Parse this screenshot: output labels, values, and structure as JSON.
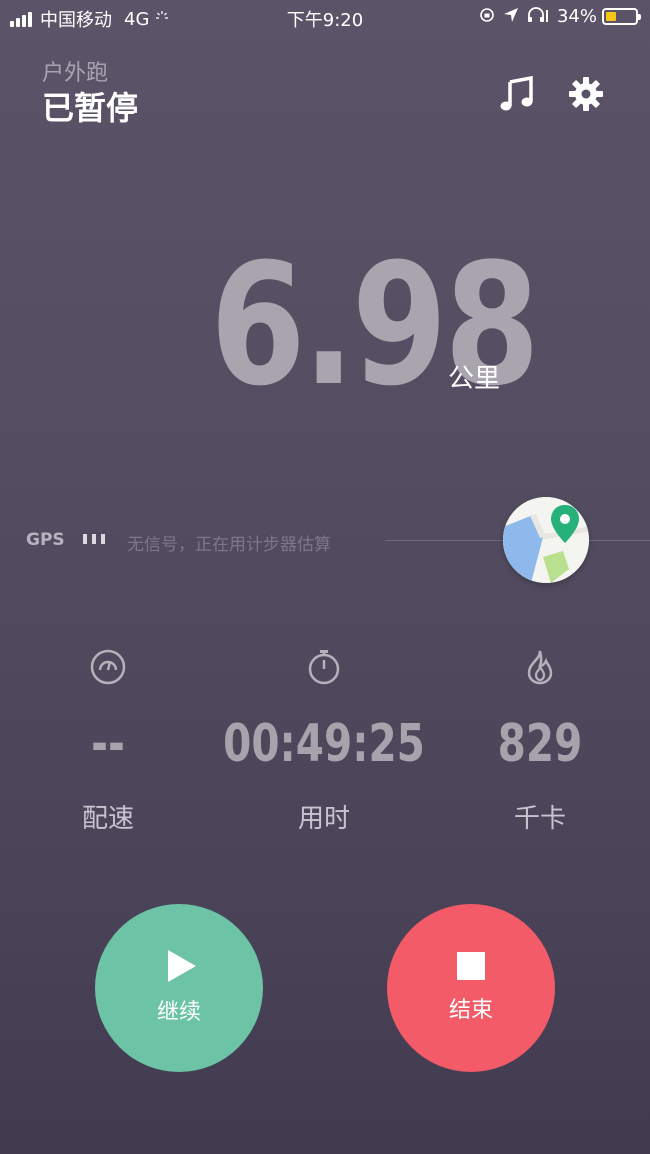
{
  "status_bar": {
    "carrier": "中国移动",
    "network": "4G",
    "time": "下午9:20",
    "battery_percent": "34%",
    "battery_level": 0.34,
    "battery_color": "#f5c518"
  },
  "header": {
    "activity_type": "户外跑",
    "state": "已暂停",
    "music_icon": "music-note-icon",
    "settings_icon": "gear-icon"
  },
  "distance": {
    "value": "6.98",
    "unit": "公里"
  },
  "gps": {
    "label": "GPS",
    "signal_bars": 3,
    "message": "无信号，正在用计步器估算",
    "map_icon": "map-pin-icon"
  },
  "stats": [
    {
      "icon": "speedometer-icon",
      "value": "--",
      "label": "配速"
    },
    {
      "icon": "stopwatch-icon",
      "value": "00:49:25",
      "label": "用时"
    },
    {
      "icon": "flame-icon",
      "value": "829",
      "label": "千卡"
    }
  ],
  "actions": {
    "resume_label": "继续",
    "end_label": "结束",
    "resume_color": "#6cc3a6",
    "end_color": "#f25b67"
  }
}
